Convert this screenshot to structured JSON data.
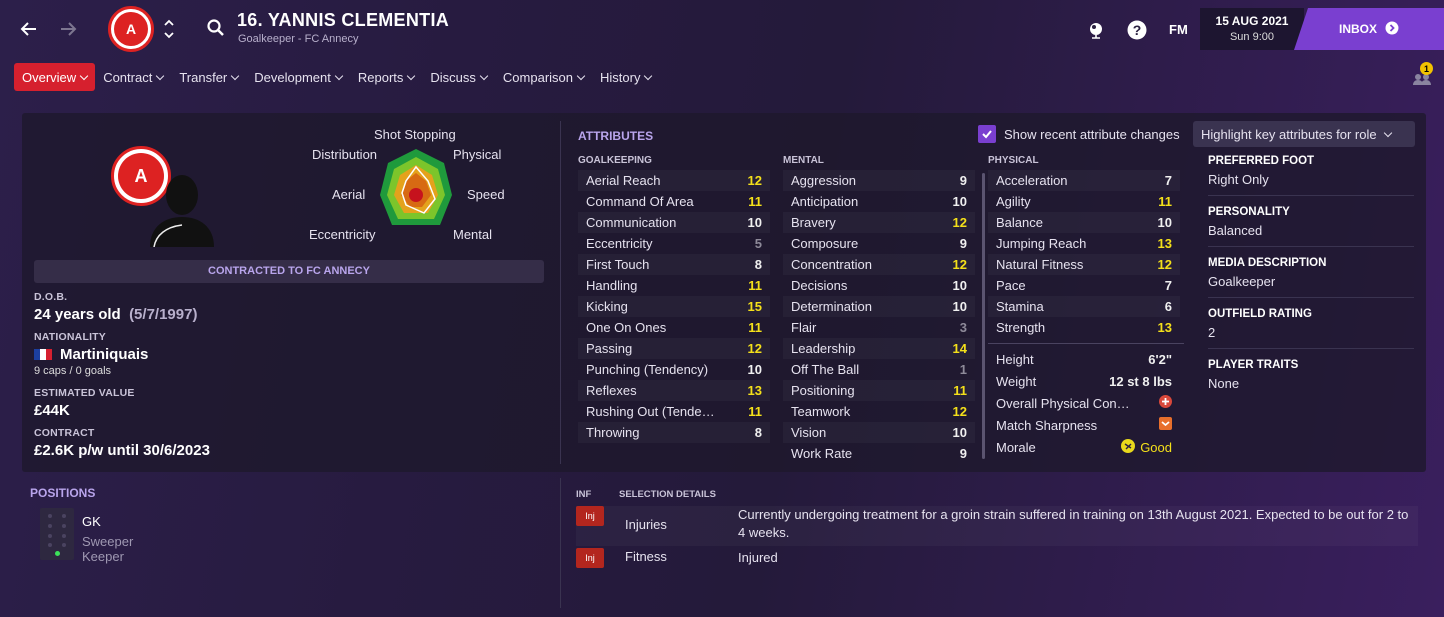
{
  "header": {
    "title": "16. YANNIS CLEMENTIA",
    "subtitle": "Goalkeeper - FC Annecy",
    "fm_label": "FM",
    "date": "15 AUG 2021",
    "time": "Sun 9:00",
    "inbox_label": "INBOX",
    "notification_count": "1"
  },
  "menu": [
    "Overview",
    "Contract",
    "Transfer",
    "Development",
    "Reports",
    "Discuss",
    "Comparison",
    "History"
  ],
  "radar": {
    "labels": {
      "top": "Shot Stopping",
      "top_left": "Distribution",
      "top_right": "Physical",
      "left": "Aerial",
      "right": "Speed",
      "bottom_left": "Eccentricity",
      "bottom_right": "Mental"
    }
  },
  "profile": {
    "contracted_label": "CONTRACTED TO FC ANNECY",
    "dob_label": "D.O.B.",
    "age": "24 years old",
    "dob": "(5/7/1997)",
    "nationality_label": "NATIONALITY",
    "nationality": "Martiniquais",
    "caps": "9 caps / 0 goals",
    "value_label": "ESTIMATED VALUE",
    "value": "£44K",
    "contract_label": "CONTRACT",
    "contract": "£2.6K p/w until 30/6/2023"
  },
  "attributes": {
    "title": "ATTRIBUTES",
    "show_changes_label": "Show recent attribute changes",
    "highlight_label": "Highlight key attributes for role",
    "goalkeeping_label": "GOALKEEPING",
    "mental_label": "MENTAL",
    "physical_label": "PHYSICAL",
    "goalkeeping": [
      {
        "name": "Aerial Reach",
        "value": "12",
        "c": "y"
      },
      {
        "name": "Command Of Area",
        "value": "11",
        "c": "y"
      },
      {
        "name": "Communication",
        "value": "10",
        "c": "w"
      },
      {
        "name": "Eccentricity",
        "value": "5",
        "c": "g"
      },
      {
        "name": "First Touch",
        "value": "8",
        "c": "w"
      },
      {
        "name": "Handling",
        "value": "11",
        "c": "y"
      },
      {
        "name": "Kicking",
        "value": "15",
        "c": "y"
      },
      {
        "name": "One On Ones",
        "value": "11",
        "c": "y"
      },
      {
        "name": "Passing",
        "value": "12",
        "c": "y"
      },
      {
        "name": "Punching (Tendency)",
        "value": "10",
        "c": "w"
      },
      {
        "name": "Reflexes",
        "value": "13",
        "c": "y"
      },
      {
        "name": "Rushing Out (Tende…",
        "value": "11",
        "c": "y"
      },
      {
        "name": "Throwing",
        "value": "8",
        "c": "w"
      }
    ],
    "mental": [
      {
        "name": "Aggression",
        "value": "9",
        "c": "w"
      },
      {
        "name": "Anticipation",
        "value": "10",
        "c": "w"
      },
      {
        "name": "Bravery",
        "value": "12",
        "c": "y"
      },
      {
        "name": "Composure",
        "value": "9",
        "c": "w"
      },
      {
        "name": "Concentration",
        "value": "12",
        "c": "y"
      },
      {
        "name": "Decisions",
        "value": "10",
        "c": "w"
      },
      {
        "name": "Determination",
        "value": "10",
        "c": "w"
      },
      {
        "name": "Flair",
        "value": "3",
        "c": "g"
      },
      {
        "name": "Leadership",
        "value": "14",
        "c": "y"
      },
      {
        "name": "Off The Ball",
        "value": "1",
        "c": "g"
      },
      {
        "name": "Positioning",
        "value": "11",
        "c": "y"
      },
      {
        "name": "Teamwork",
        "value": "12",
        "c": "y"
      },
      {
        "name": "Vision",
        "value": "10",
        "c": "w"
      },
      {
        "name": "Work Rate",
        "value": "9",
        "c": "w"
      }
    ],
    "physical": [
      {
        "name": "Acceleration",
        "value": "7",
        "c": "w"
      },
      {
        "name": "Agility",
        "value": "11",
        "c": "y"
      },
      {
        "name": "Balance",
        "value": "10",
        "c": "w"
      },
      {
        "name": "Jumping Reach",
        "value": "13",
        "c": "y"
      },
      {
        "name": "Natural Fitness",
        "value": "12",
        "c": "y"
      },
      {
        "name": "Pace",
        "value": "7",
        "c": "w"
      },
      {
        "name": "Stamina",
        "value": "6",
        "c": "w"
      },
      {
        "name": "Strength",
        "value": "13",
        "c": "y"
      }
    ],
    "details": {
      "height_label": "Height",
      "height": "6'2\"",
      "weight_label": "Weight",
      "weight": "12 st 8 lbs",
      "overall_label": "Overall Physical Con…",
      "sharpness_label": "Match Sharpness",
      "morale_label": "Morale",
      "morale": "Good"
    }
  },
  "side_info": {
    "foot_label": "PREFERRED FOOT",
    "foot": "Right Only",
    "personality_label": "PERSONALITY",
    "personality": "Balanced",
    "media_label": "MEDIA DESCRIPTION",
    "media": "Goalkeeper",
    "outfield_label": "OUTFIELD RATING",
    "outfield": "2",
    "traits_label": "PLAYER TRAITS",
    "traits": "None"
  },
  "positions": {
    "title": "POSITIONS",
    "position": "GK",
    "role": "Sweeper Keeper"
  },
  "selection": {
    "inf_label": "INF",
    "details_label": "SELECTION DETAILS",
    "rows": [
      {
        "badge": "Inj",
        "category": "Injuries",
        "text": "Currently undergoing treatment for a groin strain suffered in training on 13th August 2021. Expected to be out for 2 to 4 weeks."
      },
      {
        "badge": "Inj",
        "category": "Fitness",
        "text": "Injured"
      }
    ]
  },
  "colors": {
    "accent": "#7a3fd0",
    "active_tab": "#d6202e",
    "high_attr": "#f4e01a",
    "low_attr": "#8e8a99"
  }
}
